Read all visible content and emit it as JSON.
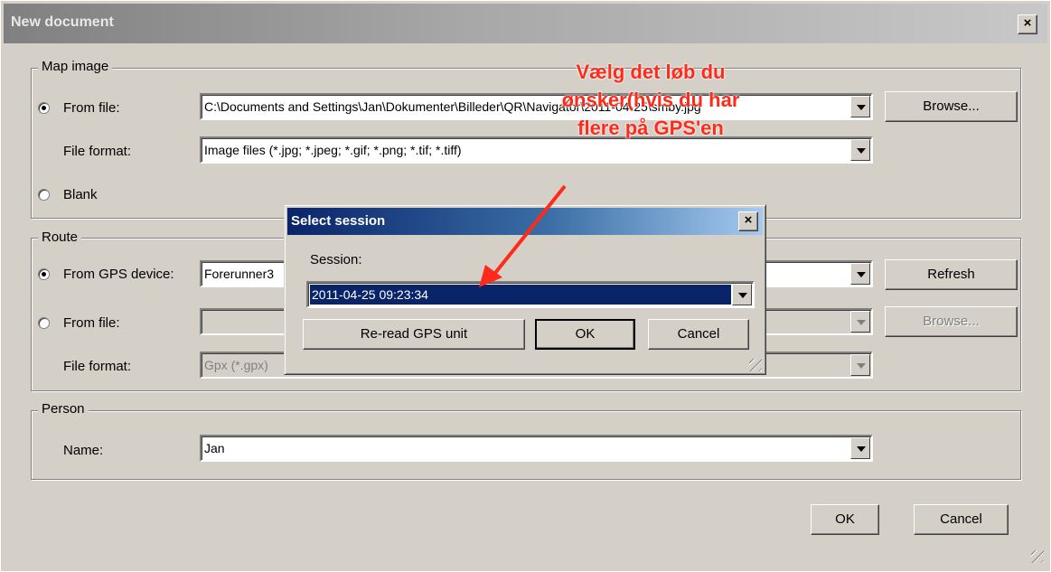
{
  "window": {
    "title": "New document",
    "close_label": "×"
  },
  "map_image": {
    "legend": "Map image",
    "from_file_label": "From file:",
    "file_path": "C:\\Documents and Settings\\Jan\\Dokumenter\\Billeder\\QR\\Navigator\\2011-04-25\\smby.jpg",
    "browse_label": "Browse...",
    "file_format_label": "File format:",
    "file_format_value": "Image files  (*.jpg; *.jpeg; *.gif; *.png; *.tif; *.tiff)",
    "blank_label": "Blank",
    "selected": "from_file"
  },
  "route": {
    "legend": "Route",
    "from_gps_label": "From GPS device:",
    "gps_device_value": "Forerunner3",
    "refresh_label": "Refresh",
    "from_file_label": "From file:",
    "file_value": "",
    "browse_label": "Browse...",
    "file_format_label": "File format:",
    "file_format_value": "Gpx (*.gpx)",
    "selected": "from_gps"
  },
  "person": {
    "legend": "Person",
    "name_label": "Name:",
    "name_value": "Jan"
  },
  "footer": {
    "ok_label": "OK",
    "cancel_label": "Cancel"
  },
  "select_session": {
    "title": "Select session",
    "close_label": "×",
    "session_label": "Session:",
    "session_value": "2011-04-25 09:23:34",
    "reread_label": "Re-read GPS unit",
    "ok_label": "OK",
    "cancel_label": "Cancel"
  },
  "annotation": {
    "lines": [
      "Vælg det løb du",
      "ønsker(hvis du har",
      "flere på GPS'en"
    ],
    "color": "#ff2a1a"
  }
}
